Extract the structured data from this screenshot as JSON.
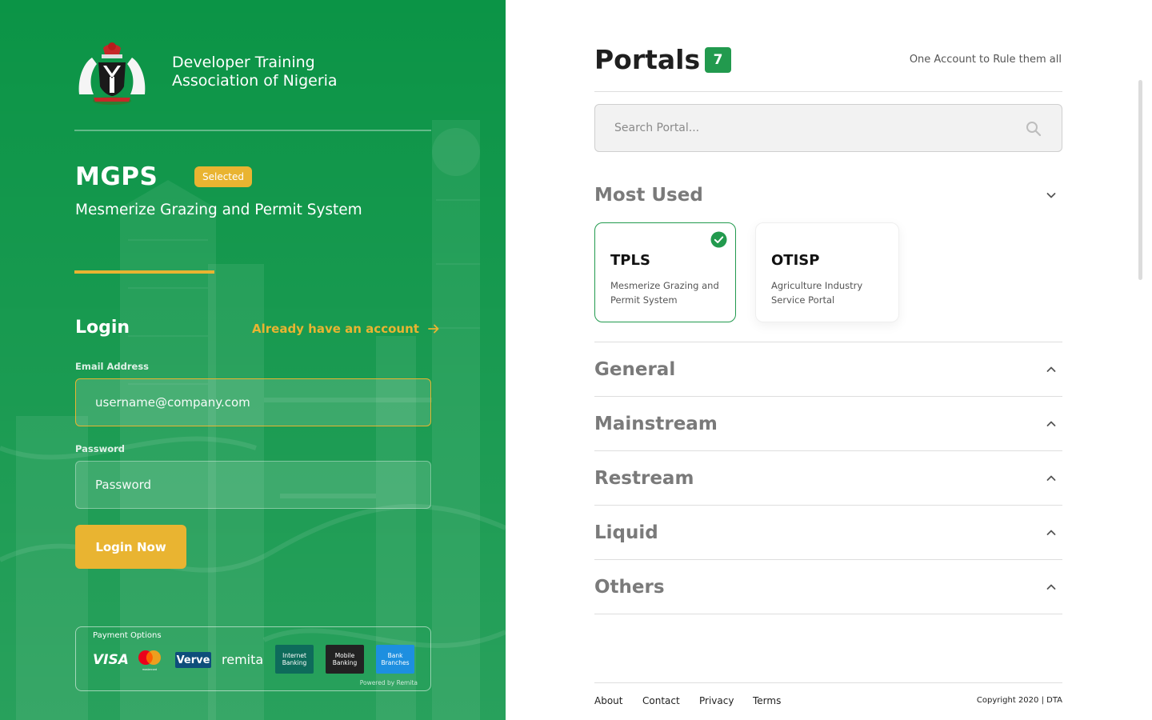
{
  "left": {
    "org_name_line1": "Developer Training",
    "org_name_line2": "Association of Nigeria",
    "system_code": "MGPS",
    "selected_badge": "Selected",
    "system_name": "Mesmerize Grazing and Permit System",
    "login": {
      "title": "Login",
      "already_link": "Already have an account",
      "email_label": "Email Address",
      "email_placeholder": "username@company.com",
      "password_label": "Password",
      "password_placeholder": "Password",
      "submit_label": "Login Now"
    },
    "payment": {
      "title": "Payment Options",
      "powered_by": "Powered by Remita",
      "logos": {
        "visa": "VISA",
        "mastercard_caption": "mastercard",
        "verve": "Verve",
        "remita": "remita",
        "internet_banking": "Internet Banking",
        "mobile_banking": "Mobile Banking",
        "bank_branches": "Bank Branches"
      }
    }
  },
  "right": {
    "title": "Portals",
    "count": "7",
    "tagline": "One Account to Rule them all",
    "search_placeholder": "Search Portal...",
    "sections": [
      {
        "title": "Most Used",
        "expanded": true
      },
      {
        "title": "General",
        "expanded": false
      },
      {
        "title": "Mainstream",
        "expanded": false
      },
      {
        "title": "Restream",
        "expanded": false
      },
      {
        "title": "Liquid",
        "expanded": false
      },
      {
        "title": "Others",
        "expanded": false
      }
    ],
    "cards": [
      {
        "code": "TPLS",
        "description": "Mesmerize Grazing and Permit System",
        "selected": true
      },
      {
        "code": "OTISP",
        "description": "Agriculture Industry Service Portal",
        "selected": false
      }
    ],
    "footer": {
      "links": [
        "About",
        "Contact",
        "Privacy",
        "Terms"
      ],
      "copyright": "Copyright 2020 | DTA"
    }
  },
  "colors": {
    "brand_green": "#0b9446",
    "accent_yellow": "#e9b431",
    "badge_green": "#229a4e"
  },
  "icons": [
    "nigeria-coat-of-arms-icon",
    "arrow-right-icon",
    "search-icon",
    "chevron-down-icon",
    "chevron-up-icon",
    "check-circle-icon"
  ]
}
